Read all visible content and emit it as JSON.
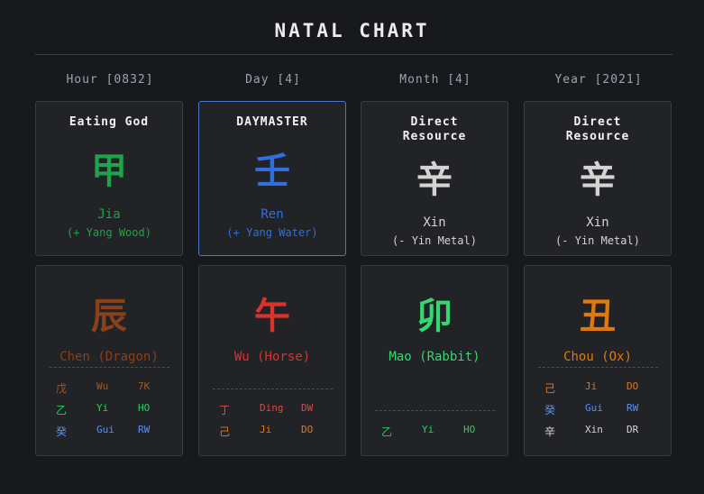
{
  "title": "NATAL CHART",
  "columns": [
    {
      "header": "Hour [0832]",
      "stem": {
        "role": "Eating God",
        "char": "甲",
        "name": "Jia",
        "element": "(+ Yang Wood)",
        "color": "#1fa24a"
      },
      "branch": {
        "char": "辰",
        "name": "Chen (Dragon)",
        "color": "#8a4018",
        "hidden": [
          {
            "char": "戊",
            "pinyin": "Wu",
            "god": "7K",
            "color": "#a05a22"
          },
          {
            "char": "乙",
            "pinyin": "Yi",
            "god": "HO",
            "color": "#2ecc60"
          },
          {
            "char": "癸",
            "pinyin": "Gui",
            "god": "RW",
            "color": "#5b8def"
          }
        ]
      }
    },
    {
      "header": "Day [4]",
      "daymaster": true,
      "stem": {
        "role": "DAYMASTER",
        "char": "壬",
        "name": "Ren",
        "element": "(+ Yang Water)",
        "color": "#2f6fe0"
      },
      "branch": {
        "char": "午",
        "name": "Wu (Horse)",
        "color": "#d9342b",
        "hidden": [
          {
            "char": "丁",
            "pinyin": "Ding",
            "god": "DW",
            "color": "#e04a3a"
          },
          {
            "char": "己",
            "pinyin": "Ji",
            "god": "DO",
            "color": "#d97a26"
          }
        ]
      }
    },
    {
      "header": "Month [4]",
      "stem": {
        "role": "Direct\nResource",
        "char": "辛",
        "name": "Xin",
        "element": "(- Yin Metal)",
        "color": "#d4d4d4"
      },
      "branch": {
        "char": "卯",
        "name": "Mao (Rabbit)",
        "color": "#36d670",
        "hidden": [
          {
            "char": "乙",
            "pinyin": "Yi",
            "god": "HO",
            "color": "#2ecc60"
          }
        ]
      }
    },
    {
      "header": "Year [2021]",
      "stem": {
        "role": "Direct\nResource",
        "char": "辛",
        "name": "Xin",
        "element": "(- Yin Metal)",
        "color": "#d4d4d4"
      },
      "branch": {
        "char": "丑",
        "name": "Chou (Ox)",
        "color": "#e0790d",
        "hidden": [
          {
            "char": "己",
            "pinyin": "Ji",
            "god": "DO",
            "color": "#d97a26"
          },
          {
            "char": "癸",
            "pinyin": "Gui",
            "god": "RW",
            "color": "#5b8def"
          },
          {
            "char": "辛",
            "pinyin": "Xin",
            "god": "DR",
            "color": "#d4d4d4"
          }
        ]
      }
    }
  ]
}
